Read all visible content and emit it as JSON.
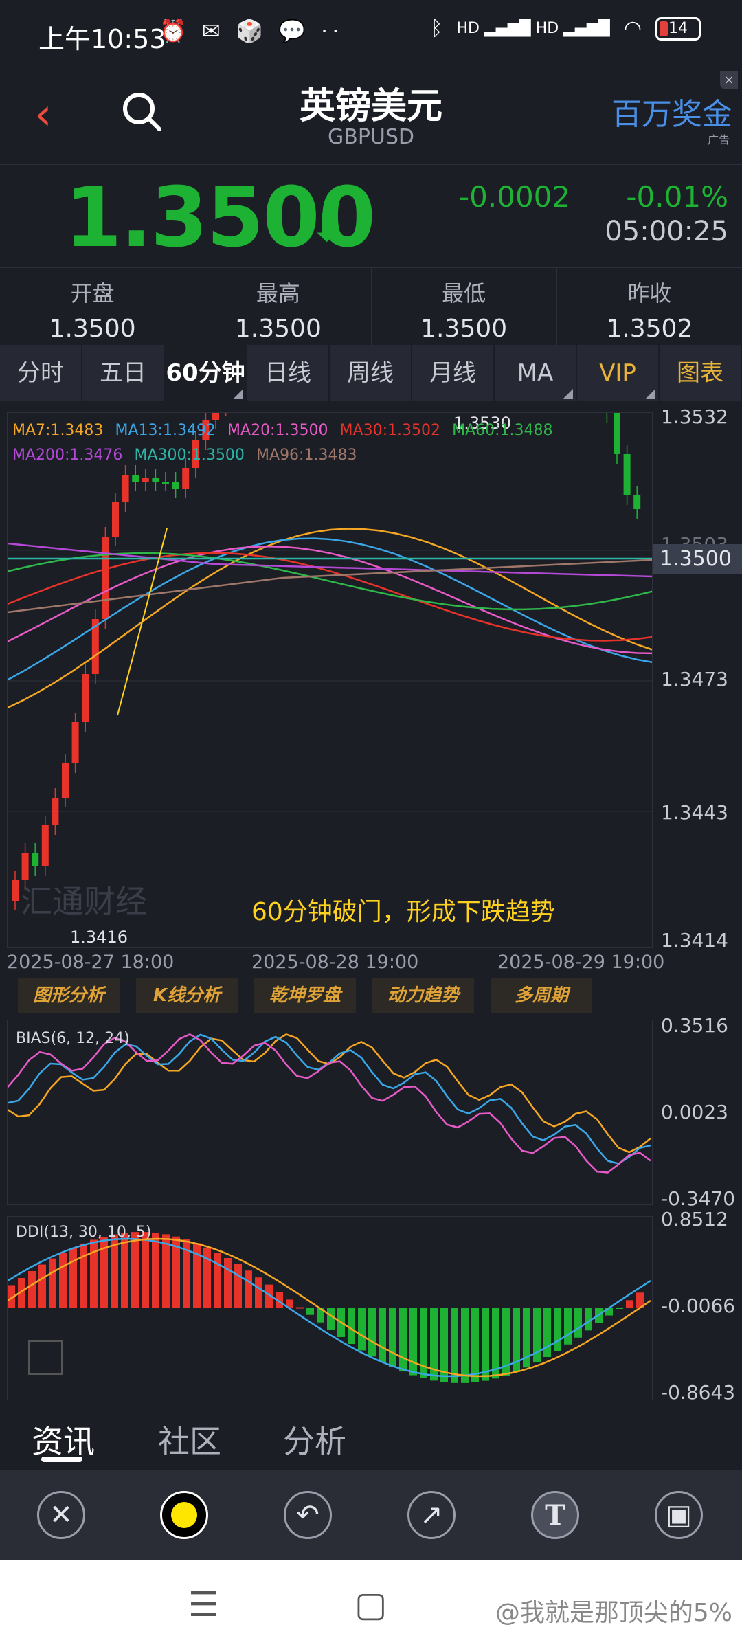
{
  "status_bar": {
    "time": "上午10:53",
    "left_icons": "⏰ ✉ 🎲 💬 ··",
    "network": "HD ▂▄▆█ HD ▂▄▆█",
    "battery": "14"
  },
  "header": {
    "title": "英镑美元",
    "symbol": "GBPUSD",
    "ad_text": "百万奖金",
    "ad_tag": "广告",
    "ad_close": "×"
  },
  "quote": {
    "price": "1.3500",
    "change": "-0.0002",
    "change_pct": "-0.01%",
    "time": "05:00:25"
  },
  "stats": [
    {
      "label": "开盘",
      "value": "1.3500"
    },
    {
      "label": "最高",
      "value": "1.3500"
    },
    {
      "label": "最低",
      "value": "1.3500"
    },
    {
      "label": "昨收",
      "value": "1.3502"
    }
  ],
  "tabs": [
    "分时",
    "五日",
    "60分钟",
    "日线",
    "周线",
    "月线",
    "MA",
    "VIP",
    "图表"
  ],
  "main_chart": {
    "y_labels": [
      "1.3532",
      "1.3503",
      "1.3473",
      "1.3443",
      "1.3414"
    ],
    "current": "1.3500",
    "high_label": "1.3530",
    "low_label": "1.3416",
    "x_labels": [
      "2025-08-27 18:00",
      "2025-08-28 19:00",
      "2025-08-29 19:00"
    ],
    "legend": [
      {
        "text": "MA7:1.3483",
        "color": "#f5a623"
      },
      {
        "text": "MA13:1.3492",
        "color": "#3aa8e8"
      },
      {
        "text": "MA20:1.3500",
        "color": "#e65bc7"
      },
      {
        "text": "MA30:1.3502",
        "color": "#e8332b"
      },
      {
        "text": "MA60:1.3488",
        "color": "#2fb84a"
      },
      {
        "text": "MA200:1.3476",
        "color": "#b44ad6"
      },
      {
        "text": "MA300:1.3500",
        "color": "#2cb6a8"
      },
      {
        "text": "MA96:1.3483",
        "color": "#a0786a"
      }
    ],
    "annotation": "60分钟破门，形成下跌趋势",
    "watermark": "汇通财经"
  },
  "tool_buttons": [
    "图形分析",
    "K线分析",
    "乾坤罗盘",
    "动力趋势",
    "多周期"
  ],
  "bias_panel": {
    "label": "BIAS(6, 12, 24)",
    "y_labels": [
      "0.3516",
      "0.0023",
      "-0.3470"
    ]
  },
  "ddi_panel": {
    "label": "DDI(13, 30, 10, 5)",
    "y_labels": [
      "0.8512",
      "-0.0066",
      "-0.8643"
    ]
  },
  "bottom_tabs": [
    "资讯",
    "社区",
    "分析"
  ],
  "draw_tools": [
    "close-icon",
    "color-dot-icon",
    "undo-icon",
    "arrow-icon",
    "text-icon",
    "save-icon"
  ],
  "credit": "@我就是那顶尖的5%",
  "colors": {
    "up": "#e8332b",
    "down": "#1db233",
    "accent": "#e8b339"
  }
}
